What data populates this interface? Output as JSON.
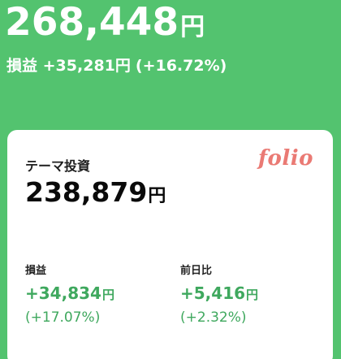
{
  "summary": {
    "total_value": "268,448",
    "total_unit": "円",
    "pl_label": "損益",
    "pl_amount": "+35,281円",
    "pl_percent": "(+16.72%)"
  },
  "card": {
    "title": "テーマ投資",
    "brand": "folio",
    "value": "238,879",
    "value_unit": "円",
    "profit": {
      "label": "損益",
      "amount": "+34,834",
      "unit": "円",
      "percent": "(+17.07%)"
    },
    "daily_change": {
      "label": "前日比",
      "amount": "+5,416",
      "unit": "円",
      "percent": "(+2.32%)"
    }
  },
  "colors": {
    "background": "#53c36f",
    "positive": "#3fa85e",
    "brand": "#ea7a74"
  }
}
